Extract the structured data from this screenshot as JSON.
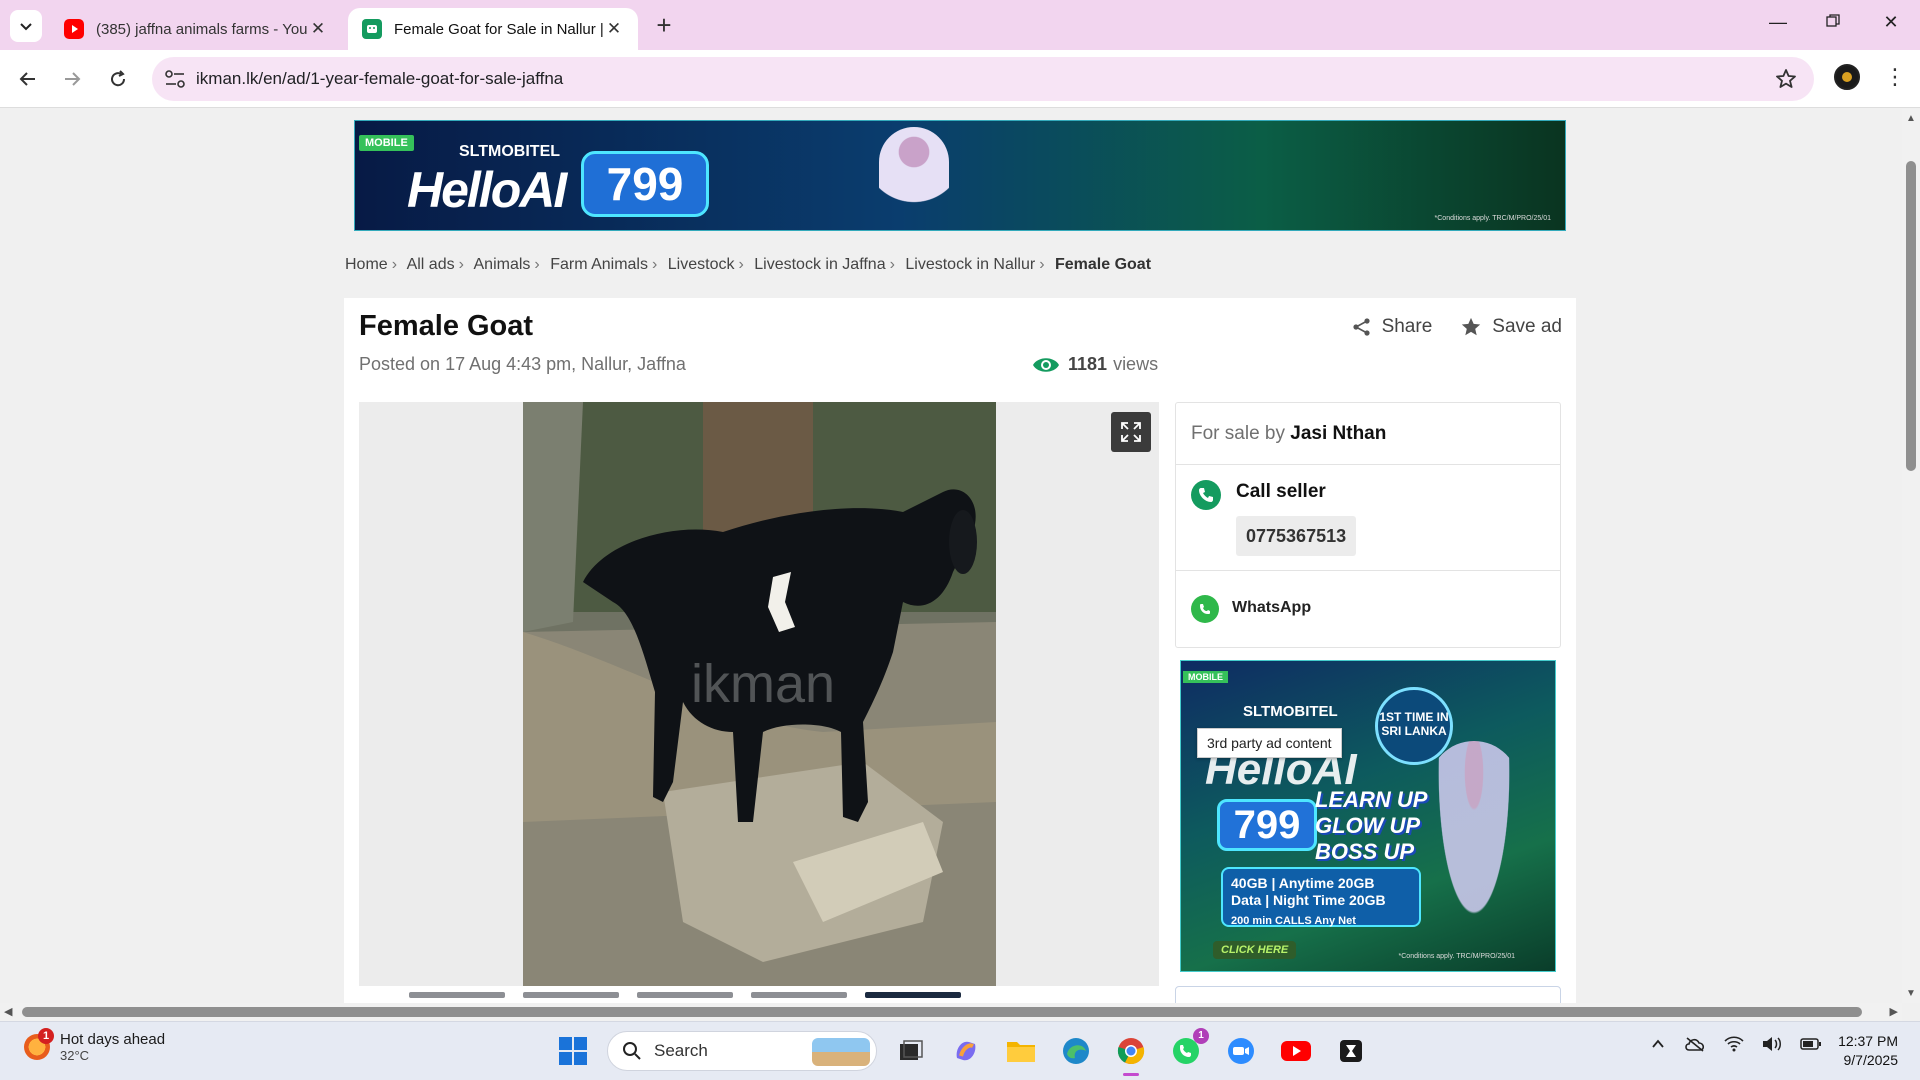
{
  "browser": {
    "tabs": [
      {
        "title": "(385) jaffna animals farms - You",
        "icon": "youtube-icon",
        "active": false
      },
      {
        "title": "Female Goat for Sale in Nallur |",
        "icon": "ikman-icon",
        "active": true
      }
    ],
    "url": "ikman.lk/en/ad/1-year-female-goat-for-sale-jaffna"
  },
  "banner": {
    "badge": "MOBILE",
    "brand": "SLTMOBITEL",
    "headline": "HelloAI",
    "price": "799",
    "fine_print": "*Conditions apply.  TRC/M/PRO/25/01"
  },
  "breadcrumbs": [
    "Home",
    "All ads",
    "Animals",
    "Farm Animals",
    "Livestock",
    "Livestock in Jaffna",
    "Livestock in Nallur"
  ],
  "breadcrumb_current": "Female Goat",
  "ad": {
    "title": "Female Goat",
    "posted": "Posted on 17 Aug 4:43 pm, Nallur, Jaffna",
    "views_count": "1181",
    "views_label": "views",
    "share_label": "Share",
    "save_label": "Save ad",
    "watermark": "ikman",
    "thumbnail_count": 5
  },
  "seller": {
    "prefix": "For sale by",
    "name": "Jasi Nthan",
    "call_label": "Call seller",
    "phone": "0775367513",
    "whatsapp_label": "WhatsApp"
  },
  "side_ad": {
    "badge": "MOBILE",
    "brand": "SLTMOBITEL",
    "first_time": "1ST TIME IN SRI LANKA",
    "tooltip": "3rd party ad content",
    "headline": "HelloAI",
    "price": "799",
    "slogan_1": "LEARN UP",
    "slogan_2": "GLOW UP",
    "slogan_3": "BOSS UP",
    "data_line_1": "40GB | Anytime 20GB",
    "data_line_2": "Data | Night Time 20GB",
    "calls": "200 min CALLS Any Net",
    "cta": "CLICK HERE",
    "fine_print": "*Conditions apply.  TRC/M/PRO/25/01"
  },
  "taskbar": {
    "weather_title": "Hot days ahead",
    "weather_temp": "32°C",
    "weather_badge": "1",
    "search_placeholder": "Search",
    "whatsapp_badge": "1",
    "time": "12:37 PM",
    "date": "9/7/2025"
  },
  "colors": {
    "tabstrip": "#f2d5ef",
    "omnibox": "#f7e4f5",
    "ikman_green": "#149b5f",
    "whatsapp_green": "#2fb84a"
  }
}
